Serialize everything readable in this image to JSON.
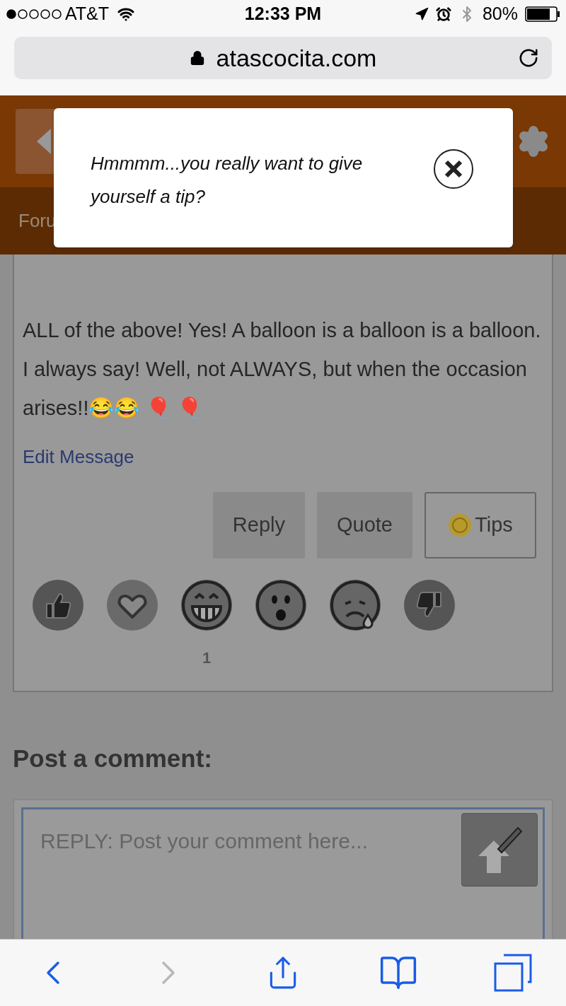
{
  "status_bar": {
    "carrier": "AT&T",
    "time": "12:33 PM",
    "battery": "80%"
  },
  "address_bar": {
    "url": "atascocita.com"
  },
  "site_header": {
    "nav_label": "Foru"
  },
  "post": {
    "text": "ALL of the above! Yes! A balloon is a balloon is a balloon. I always say! Well, not ALWAYS, but when the occasion arises!!😂😂 🎈 🎈",
    "edit_link": "Edit Message",
    "buttons": [
      {
        "label": "Reply",
        "kind": "plain"
      },
      {
        "label": "Quote",
        "kind": "plain"
      },
      {
        "label": "Tips",
        "kind": "tips"
      }
    ],
    "reactions": [
      {
        "kind": "like"
      },
      {
        "kind": "love"
      },
      {
        "kind": "laugh",
        "count": "1"
      },
      {
        "kind": "wow"
      },
      {
        "kind": "sad"
      },
      {
        "kind": "dislike"
      }
    ]
  },
  "comment": {
    "heading": "Post a comment:",
    "placeholder": "REPLY: Post your comment here..."
  },
  "dialog": {
    "message": "Hmmmm...you really want to give yourself a tip?"
  },
  "toolbar": [
    {
      "kind": "back",
      "disabled": false
    },
    {
      "kind": "forward",
      "disabled": true
    },
    {
      "kind": "share",
      "disabled": false
    },
    {
      "kind": "bookmarks",
      "disabled": false
    },
    {
      "kind": "tabs",
      "disabled": false
    }
  ]
}
